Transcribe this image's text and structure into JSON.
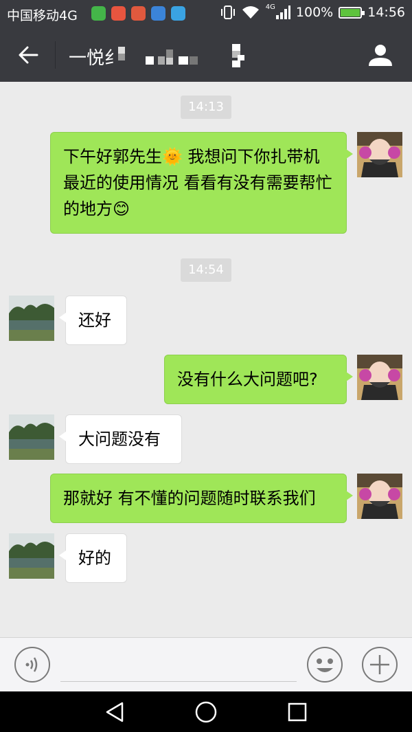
{
  "status_bar": {
    "carrier": "中国移动4G",
    "network_badge": "4G",
    "battery": "100%",
    "battery_level": 1.0,
    "time": "14:56",
    "notification_icons": [
      "wechat-icon",
      "mail-icon",
      "weibo-icon",
      "gallery-icon",
      "message-icon"
    ]
  },
  "header": {
    "title": "一悦纟",
    "back_icon": "arrow-left-icon",
    "profile_icon": "person-icon"
  },
  "messages": [
    {
      "type": "time",
      "text": "14:13"
    },
    {
      "type": "msg",
      "side": "out",
      "text": "下午好郭先生🌞 我想问下你扎带机最近的使用情况 看看有没有需要帮忙的地方😊"
    },
    {
      "type": "time",
      "text": "14:54"
    },
    {
      "type": "msg",
      "side": "in",
      "text": "还好"
    },
    {
      "type": "msg",
      "side": "out",
      "text": "没有什么大问题吧?"
    },
    {
      "type": "msg",
      "side": "in",
      "text": "大问题没有"
    },
    {
      "type": "msg",
      "side": "out",
      "text": "那就好 有不懂的问题随时联系我们"
    },
    {
      "type": "msg",
      "side": "in",
      "text": "好的"
    }
  ],
  "input_bar": {
    "value": "",
    "voice_icon": "voice-icon",
    "emoji_icon": "emoji-icon",
    "more_icon": "plus-icon"
  },
  "nav_bar": {
    "icons": [
      "back-triangle-icon",
      "home-circle-icon",
      "recents-square-icon"
    ]
  },
  "colors": {
    "header_bg": "#393a3f",
    "chat_bg": "#ebebeb",
    "outgoing_bubble": "#9fe658",
    "incoming_bubble": "#ffffff",
    "battery_green": "#5ec33d"
  }
}
